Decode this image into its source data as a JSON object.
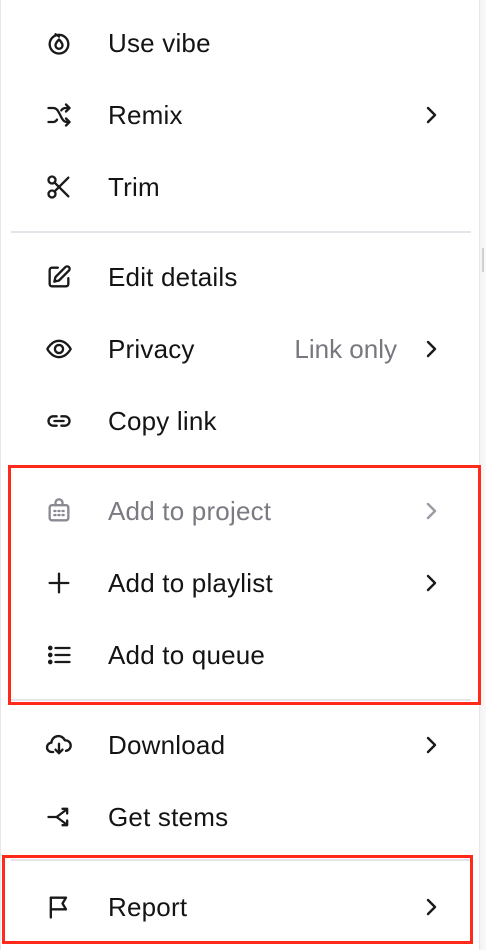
{
  "menu": {
    "items": [
      {
        "label": "Use vibe",
        "icon": "vibe-icon"
      },
      {
        "label": "Remix",
        "icon": "shuffle-icon",
        "has_submenu": true
      },
      {
        "label": "Trim",
        "icon": "scissors-icon"
      },
      {
        "label": "Edit details",
        "icon": "pencil-square-icon"
      },
      {
        "label": "Privacy",
        "icon": "eye-icon",
        "value": "Link only",
        "has_submenu": true
      },
      {
        "label": "Copy link",
        "icon": "link-icon"
      },
      {
        "label": "Add to project",
        "icon": "project-icon",
        "has_submenu": true,
        "disabled": true
      },
      {
        "label": "Add to playlist",
        "icon": "plus-icon",
        "has_submenu": true
      },
      {
        "label": "Add to queue",
        "icon": "list-icon"
      },
      {
        "label": "Download",
        "icon": "cloud-download-icon",
        "has_submenu": true
      },
      {
        "label": "Get stems",
        "icon": "split-icon"
      },
      {
        "label": "Report",
        "icon": "flag-icon",
        "has_submenu": true
      }
    ]
  },
  "colors": {
    "highlight": "#ff2a1a",
    "text": "#141414",
    "muted": "#77777f",
    "divider": "#e4e4ea"
  }
}
